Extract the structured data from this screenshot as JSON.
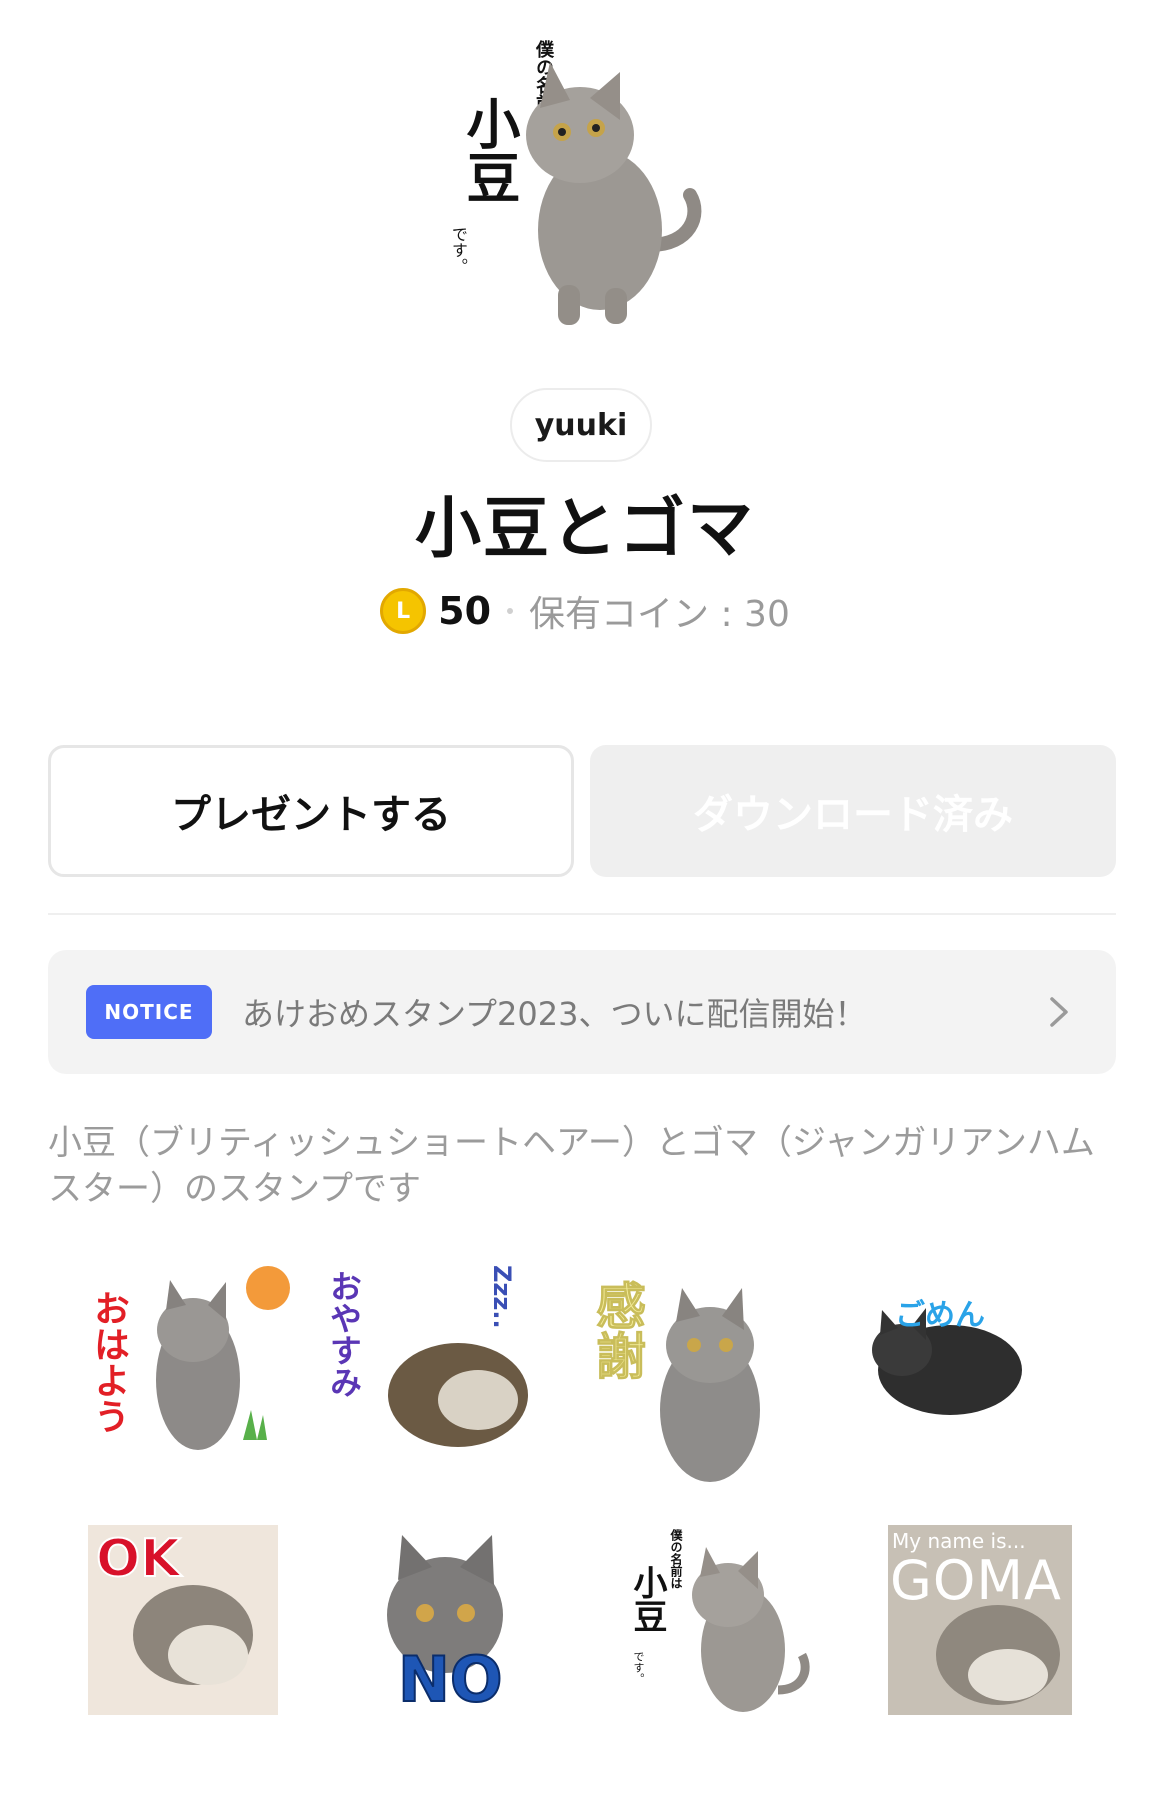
{
  "hero": {
    "vertical_text": "僕の名前は",
    "name_big": "小豆",
    "suffix": "です。"
  },
  "author": "yuuki",
  "title": "小豆とゴマ",
  "price": {
    "coin_symbol": "L",
    "amount": "50",
    "coins_held": "保有コイン : 30"
  },
  "buttons": {
    "gift": "プレゼントする",
    "download": "ダウンロード済み"
  },
  "notice": {
    "badge": "NOTICE",
    "text": "あけおめスタンプ2023、ついに配信開始！"
  },
  "description": "小豆（ブリティッシュショートヘアー）とゴマ（ジャンガリアンハムスター）のスタンプです",
  "stickers": [
    {
      "caption": "おはよう"
    },
    {
      "caption": "おやすみ",
      "extra": "Zzz.."
    },
    {
      "caption": "感謝"
    },
    {
      "caption": "ごめん"
    },
    {
      "caption": "OK"
    },
    {
      "caption": "NO"
    },
    {
      "caption": "小豆",
      "vertical_text": "僕の名前は",
      "suffix": "です。"
    },
    {
      "caption": "GOMA",
      "small": "My name is..."
    }
  ],
  "colors": {
    "notice_badge": "#4f6ef7",
    "coin": "#f5c400",
    "muted_text": "#9b9b9b"
  }
}
